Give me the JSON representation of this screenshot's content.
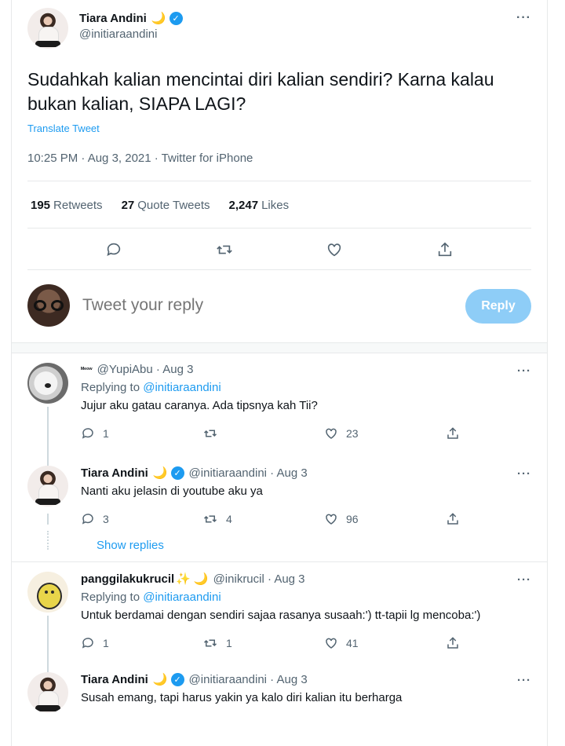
{
  "tweet": {
    "author_name": "Tiara Andini",
    "author_moon": "🌙",
    "author_handle": "@initiaraandini",
    "more_label": "···",
    "text": "Sudahkah kalian mencintai diri kalian sendiri? Karna kalau bukan kalian, SIAPA LAGI?",
    "translate_label": "Translate Tweet",
    "meta": "10:25 PM · Aug 3, 2021 · Twitter for iPhone",
    "stats": {
      "retweets_count": "195",
      "retweets_label": "Retweets",
      "quotes_count": "27",
      "quotes_label": "Quote Tweets",
      "likes_count": "2,247",
      "likes_label": "Likes"
    }
  },
  "reply_box": {
    "placeholder": "Tweet your reply",
    "button_label": "Reply"
  },
  "replies": [
    {
      "name": "ᴹᵉᵒʷ",
      "handle": "@YupiAbu · Aug 3",
      "replying_prefix": "Replying to",
      "replying_to": "@initiaraandini",
      "text": "Jujur aku gatau caranya. Ada tipsnya kah Tii?",
      "replies_count": "1",
      "retweets_count": "",
      "likes_count": "23"
    },
    {
      "name": "Tiara Andini",
      "moon": "🌙",
      "handle": "@initiaraandini · Aug 3",
      "text": "Nanti aku jelasin di youtube aku ya",
      "replies_count": "3",
      "retweets_count": "4",
      "likes_count": "96"
    },
    {
      "name": "panggilakukrucil",
      "sparkle": "✨",
      "moon": "🌙",
      "handle": "@inikrucil · Aug 3",
      "replying_prefix": "Replying to",
      "replying_to": "@initiaraandini",
      "text": "Untuk berdamai dengan sendiri sajaa rasanya susaah:') tt-tapii lg mencoba:')",
      "replies_count": "1",
      "retweets_count": "1",
      "likes_count": "41"
    },
    {
      "name": "Tiara Andini",
      "moon": "🌙",
      "handle": "@initiaraandini · Aug 3",
      "text": "Susah emang, tapi harus yakin ya kalo diri kalian itu berharga"
    }
  ],
  "show_replies_label": "Show replies",
  "colors": {
    "accent": "#1d9bf0",
    "muted": "#536471",
    "reply_button": "#8ecdf7"
  },
  "icons": [
    "comment-icon",
    "retweet-icon",
    "heart-icon",
    "share-icon",
    "verified-icon",
    "more-icon"
  ]
}
